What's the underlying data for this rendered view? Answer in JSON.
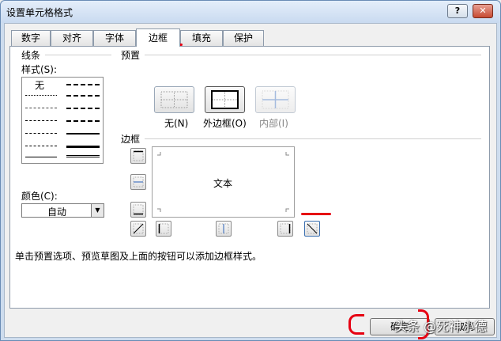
{
  "window": {
    "title": "设置单元格格式",
    "help_label": "?",
    "close_label": "✕"
  },
  "tabs": [
    {
      "label": "数字"
    },
    {
      "label": "对齐"
    },
    {
      "label": "字体"
    },
    {
      "label": "边框",
      "active": true
    },
    {
      "label": "填充"
    },
    {
      "label": "保护"
    }
  ],
  "line": {
    "group_label": "线条",
    "style_label": "样式(S):",
    "none_label": "无",
    "color_label": "颜色(C):",
    "color_value": "自动"
  },
  "presets": {
    "group_label": "预置",
    "items": [
      {
        "label": "无(N)",
        "icon": "preset-none-icon"
      },
      {
        "label": "外边框(O)",
        "icon": "preset-outline-icon"
      },
      {
        "label": "内部(I)",
        "icon": "preset-inside-icon",
        "disabled": true
      }
    ]
  },
  "border": {
    "group_label": "边框",
    "preview_text": "文本"
  },
  "hint": "单击预置选项、预览草图及上面的按钮可以添加边框样式。",
  "buttons": {
    "ok": "确定",
    "cancel": "取消"
  },
  "watermark": "头条 @死神小德",
  "colors": {
    "annotation": "#e60012",
    "title_bg": "#c9daf0",
    "panel_bg": "#ffffff"
  }
}
